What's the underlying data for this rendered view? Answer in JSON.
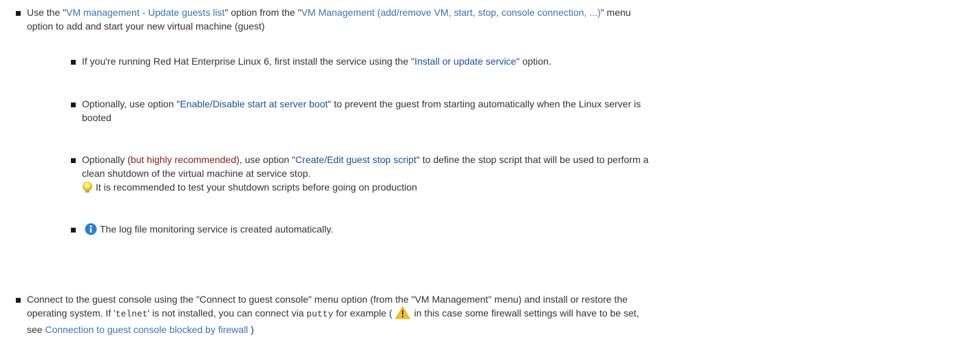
{
  "items": {
    "add_vm": {
      "prefix": "Use the \"",
      "link1": "VM management - Update guests list",
      "mid": "\" option from the \"",
      "link2": "VM Management (add/remove VM, start, stop, console connection, ...)",
      "suffix": "\" menu",
      "line2": "option to add and start your new virtual machine (guest)"
    },
    "rhel6": {
      "prefix": "If you're running Red Hat Enterprise Linux 6, first install the service using the \"",
      "link": "Install or update service",
      "suffix": "\" option."
    },
    "boot": {
      "prefix": "Optionally, use option \"",
      "link": "Enable/Disable start at server boot",
      "suffix": "\" to prevent the guest from starting automatically when the Linux server is",
      "line2": "booted"
    },
    "stop_script": {
      "prefix": "Optionally (",
      "red": "but highly recommended",
      "mid": "), use option \"",
      "link": "Create/Edit guest stop script",
      "suffix": "\" to define the stop script that will be used to perform a",
      "line2": "clean shutdown of the virtual machine at service stop.",
      "tip": "It is recommended to test your shutdown scripts before going on production",
      "tip_icon": "lightbulb-icon"
    },
    "log_monitor": {
      "text": "The log file monitoring service is created automatically.",
      "icon": "info-icon"
    },
    "console": {
      "line1": "Connect to the guest console using the \"Connect to guest console\" menu option (from the \"VM Management\" menu) and install or restore the",
      "l2_prefix": "operating system. If '",
      "telnet": "telnet",
      "l2_mid": "' is not installed, you can connect via ",
      "putty": "putty",
      "l2_mid2": " for example ( ",
      "l2_suffix": " in this case some firewall settings will have to be set,",
      "l3_prefix": "see ",
      "link": "Connection to guest console blocked by firewall",
      "l3_suffix": " )",
      "warn_icon": "warning-icon"
    }
  },
  "colors": {
    "link": "#3b73af",
    "dark_link": "#1d4e9b",
    "emphasis": "#8b1a1a",
    "text": "#333333"
  }
}
